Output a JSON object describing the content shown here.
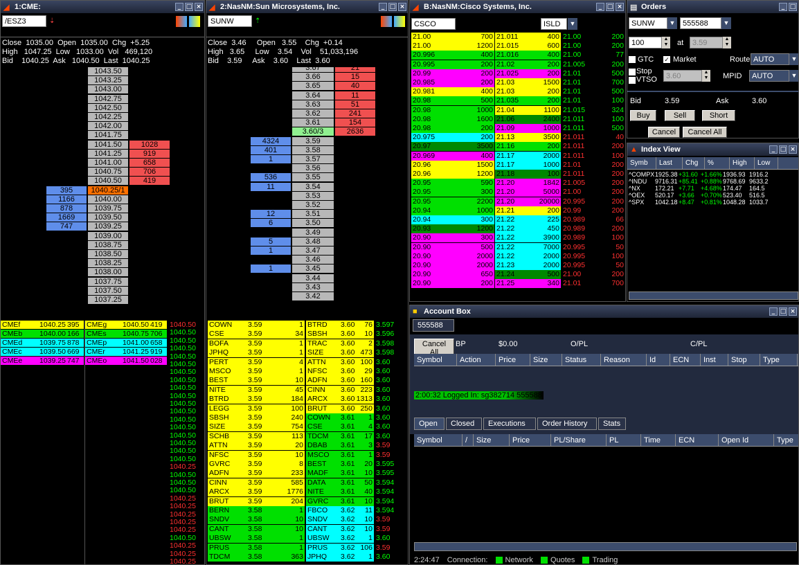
{
  "win1": {
    "title": "1:CME:",
    "symbol": "/ESZ3",
    "q": [
      "Close  1035.00  Open  1035.00  Chg  +5.25",
      "High   1047.25  Low   1033.00  Vol   469,120",
      "Bid    1040.25  Ask   1040.50  Last  1040.25"
    ],
    "chg_color": "#00ff00"
  },
  "win2": {
    "title": "2:NasNM:Sun Microsystems, Inc.",
    "symbol": "SUNW",
    "q": [
      "Close  3.46     Open   3.55    Chg  +0.14",
      "High   3.65     Low    3.54    Vol    51,033,196",
      "Bid    3.59     Ask    3.60    Last  3.60"
    ]
  },
  "win3": {
    "title": "B:NasNM:Cisco Systems, Inc.",
    "symbol": "CSCO",
    "ecn": "ISLD"
  },
  "orders": {
    "title": "Orders",
    "symbol": "SUNW",
    "account": "555588",
    "qty": "100",
    "at": "at",
    "price": "3.59",
    "gtc": "GTC",
    "market": "Market",
    "route_label": "Route",
    "route": "AUTO",
    "stop": "Stop",
    "vtso": "VTSO",
    "stop_price": "3.60",
    "mpid_label": "MPID",
    "mpid": "AUTO",
    "bid_label": "Bid",
    "bid": "3.59",
    "ask_label": "Ask",
    "ask": "3.60",
    "buy": "Buy",
    "sell": "Sell",
    "short": "Short",
    "cancel": "Cancel",
    "cancel_all": "Cancel All"
  },
  "index": {
    "title": "Index View",
    "cols": [
      "Symb",
      "Last",
      "Chg",
      "%",
      "High",
      "Low"
    ],
    "rows": [
      [
        "^COMPX",
        "1925.38",
        "+31.60",
        "+1.66%",
        "1936.93",
        "1916.2"
      ],
      [
        "^INDU",
        "9716.31",
        "+85.41",
        "+0.88%",
        "9768.69",
        "9633.2"
      ],
      [
        "^NX",
        "172.21",
        "+7.71",
        "+4.68%",
        "174.47",
        "164.5"
      ],
      [
        "^OEX",
        "520.17",
        "+3.66",
        "+0.70%",
        "523.40",
        "516.5"
      ],
      [
        "^SPX",
        "1042.18",
        "+8.47",
        "+0.81%",
        "1048.28",
        "1033.7"
      ]
    ]
  },
  "account": {
    "title": "Account Box",
    "id": "555588",
    "cancel_all": "Cancel All",
    "bp_label": "BP",
    "bp": "$0.00",
    "opl": "O/PL",
    "cpl": "C/PL",
    "cols": [
      "Symbol",
      "Action",
      "Price",
      "Size",
      "Status",
      "Reason",
      "Id",
      "ECN",
      "Inst",
      "Stop",
      "Type"
    ],
    "log": "2:00:32 Logged In: sg382714 555588",
    "tabs": [
      "Open",
      "Closed",
      "Executions",
      "Order History",
      "Stats"
    ],
    "cols2": [
      "Symbol",
      "/",
      "Size",
      "Price",
      "PL/Share",
      "PL",
      "Time",
      "ECN",
      "Open Id",
      "Type"
    ],
    "status_time": "2:24:47",
    "conn": "Connection:",
    "network": "Network",
    "quotes": "Quotes",
    "trading": "Trading"
  },
  "ladder1": [
    [
      "",
      "1043.50",
      ""
    ],
    [
      "",
      "1043.25",
      ""
    ],
    [
      "",
      "1043.00",
      ""
    ],
    [
      "",
      "1042.75",
      ""
    ],
    [
      "",
      "1042.50",
      ""
    ],
    [
      "",
      "1042.25",
      ""
    ],
    [
      "",
      "1042.00",
      ""
    ],
    [
      "",
      "1041.75",
      ""
    ],
    [
      "",
      "1041.50",
      "1028"
    ],
    [
      "",
      "1041.25",
      "919"
    ],
    [
      "",
      "1041.00",
      "658"
    ],
    [
      "",
      "1040.75",
      "706"
    ],
    [
      "",
      "1040.50",
      "419"
    ],
    [
      "395",
      "1040.25/1",
      ""
    ],
    [
      "1166",
      "1040.00",
      ""
    ],
    [
      "878",
      "1039.75",
      ""
    ],
    [
      "1669",
      "1039.50",
      ""
    ],
    [
      "747",
      "1039.25",
      ""
    ],
    [
      "",
      "1039.00",
      ""
    ],
    [
      "",
      "1038.75",
      ""
    ],
    [
      "",
      "1038.50",
      ""
    ],
    [
      "",
      "1038.25",
      ""
    ],
    [
      "",
      "1038.00",
      ""
    ],
    [
      "",
      "1037.75",
      ""
    ],
    [
      "",
      "1037.50",
      ""
    ],
    [
      "",
      "1037.25",
      ""
    ]
  ],
  "ladder2": [
    [
      "",
      "3.67",
      "21"
    ],
    [
      "",
      "3.66",
      "15"
    ],
    [
      "",
      "3.65",
      "40"
    ],
    [
      "",
      "3.64",
      "11"
    ],
    [
      "",
      "3.63",
      "51"
    ],
    [
      "",
      "3.62",
      "241"
    ],
    [
      "",
      "3.61",
      "154"
    ],
    [
      "",
      "3.60/3",
      "2636"
    ],
    [
      "4324",
      "3.59",
      ""
    ],
    [
      "401",
      "3.58",
      ""
    ],
    [
      "1",
      "3.57",
      ""
    ],
    [
      "",
      "3.56",
      ""
    ],
    [
      "536",
      "3.55",
      ""
    ],
    [
      "11",
      "3.54",
      ""
    ],
    [
      "",
      "3.53",
      ""
    ],
    [
      "",
      "3.52",
      ""
    ],
    [
      "12",
      "3.51",
      ""
    ],
    [
      "6",
      "3.50",
      ""
    ],
    [
      "",
      "3.49",
      ""
    ],
    [
      "5",
      "3.48",
      ""
    ],
    [
      "1",
      "3.47",
      ""
    ],
    [
      "",
      "3.46",
      ""
    ],
    [
      "1",
      "3.45",
      ""
    ],
    [
      "",
      "3.44",
      ""
    ],
    [
      "",
      "3.43",
      ""
    ],
    [
      "",
      "3.42",
      ""
    ]
  ],
  "cme_mm": [
    [
      "CMEf",
      "1040.25",
      "395",
      "CMEg",
      "1040.50",
      "419",
      "#ffff00"
    ],
    [
      "CMEb",
      "1040.00",
      "166",
      "CMEs",
      "1040.75",
      "706",
      "#00e000"
    ],
    [
      "CMEd",
      "1039.75",
      "878",
      "CMEp",
      "1041.00",
      "658",
      "#00ffff"
    ],
    [
      "CMEc",
      "1039.50",
      "669",
      "CMEr",
      "1041.25",
      "919",
      "#00ffff"
    ],
    [
      "CMEe",
      "1039.25",
      "747",
      "CMEo",
      "1041.50",
      "028",
      "#ff00ff"
    ]
  ],
  "cme_ts": [
    [
      "1040.50",
      "1",
      "#ff3030"
    ],
    [
      "1040.50",
      "",
      "#00ff00"
    ],
    [
      "1040.50",
      "",
      "#00ff00"
    ],
    [
      "1040.50",
      "",
      "#00ff00"
    ],
    [
      "1040.50",
      "",
      "#00ff00"
    ],
    [
      "1040.50",
      "",
      "#00ff00"
    ],
    [
      "1040.50",
      "",
      "#00ff00"
    ],
    [
      "1040.50",
      "",
      "#00ff00"
    ],
    [
      "1040.50",
      "",
      "#00ff00"
    ],
    [
      "1040.50",
      "",
      "#00ff00"
    ],
    [
      "1040.50",
      "",
      "#00ff00"
    ],
    [
      "1040.50",
      "",
      "#00ff00"
    ],
    [
      "1040.50",
      "",
      "#00ff00"
    ],
    [
      "1040.50",
      "",
      "#00ff00"
    ],
    [
      "1040.50",
      "",
      "#00ff00"
    ],
    [
      "1040.50",
      "",
      "#00ff00"
    ],
    [
      "1040.50",
      "",
      "#00ff00"
    ],
    [
      "1040.50",
      "",
      "#00ff00"
    ],
    [
      "1040.25",
      "",
      "#ff3030"
    ],
    [
      "1040.50",
      "",
      "#00ff00"
    ],
    [
      "1040.50",
      "",
      "#00ff00"
    ],
    [
      "1040.50",
      "",
      "#00ff00"
    ],
    [
      "1040.25",
      "1",
      "#ff3030"
    ],
    [
      "1040.25",
      "",
      "#ff3030"
    ],
    [
      "1040.25",
      "",
      "#ff3030"
    ],
    [
      "1040.25",
      "",
      "#ff3030"
    ],
    [
      "1040.25",
      "",
      "#ff3030"
    ],
    [
      "1040.50",
      "",
      "#00ff00"
    ],
    [
      "1040.25",
      "",
      "#ff3030"
    ],
    [
      "1040.25",
      "",
      "#ff3030"
    ],
    [
      "1040.25",
      "",
      "#ff3030"
    ]
  ],
  "sun_bids": [
    [
      "COWN",
      "3.59",
      "1",
      "#ffff00"
    ],
    [
      "CSE",
      "3.59",
      "34",
      "#ffff00"
    ],
    [
      "BOFA",
      "3.59",
      "1",
      "#ffff00"
    ],
    [
      "JPHQ",
      "3.59",
      "1",
      "#ffff00"
    ],
    [
      "PERT",
      "3.59",
      "4",
      "#ffff00"
    ],
    [
      "MSCO",
      "3.59",
      "1",
      "#ffff00"
    ],
    [
      "BEST",
      "3.59",
      "10",
      "#ffff00"
    ],
    [
      "NITE",
      "3.59",
      "45",
      "#ffff00"
    ],
    [
      "BTRD",
      "3.59",
      "184",
      "#ffff00"
    ],
    [
      "LEGG",
      "3.59",
      "100",
      "#ffff00"
    ],
    [
      "SBSH",
      "3.59",
      "240",
      "#ffff00"
    ],
    [
      "SIZE",
      "3.59",
      "754",
      "#ffff00"
    ],
    [
      "SCHB",
      "3.59",
      "113",
      "#ffff00"
    ],
    [
      "ATTN",
      "3.59",
      "20",
      "#ffff00"
    ],
    [
      "NFSC",
      "3.59",
      "10",
      "#ffff00"
    ],
    [
      "GVRC",
      "3.59",
      "8",
      "#ffff00"
    ],
    [
      "ADFN",
      "3.59",
      "233",
      "#ffff00"
    ],
    [
      "CINN",
      "3.59",
      "585",
      "#ffff00"
    ],
    [
      "ARCX",
      "3.59",
      "1776",
      "#ffff00"
    ],
    [
      "BRUT",
      "3.59",
      "204",
      "#ffff00"
    ],
    [
      "BERN",
      "3.58",
      "1",
      "#00e000"
    ],
    [
      "SNDV",
      "3.58",
      "10",
      "#00e000"
    ],
    [
      "CANT",
      "3.58",
      "10",
      "#00e000"
    ],
    [
      "UBSW",
      "3.58",
      "1",
      "#00e000"
    ],
    [
      "PRUS",
      "3.58",
      "1",
      "#00e000"
    ],
    [
      "TDCM",
      "3.58",
      "363",
      "#00e000"
    ]
  ],
  "sun_asks": [
    [
      "BTRD",
      "3.60",
      "76",
      "#ffff00"
    ],
    [
      "SBSH",
      "3.60",
      "10",
      "#ffff00"
    ],
    [
      "TRAC",
      "3.60",
      "2",
      "#ffff00"
    ],
    [
      "SIZE",
      "3.60",
      "473",
      "#ffff00"
    ],
    [
      "ATTN",
      "3.60",
      "100",
      "#ffff00"
    ],
    [
      "NFSC",
      "3.60",
      "29",
      "#ffff00"
    ],
    [
      "ADFN",
      "3.60",
      "160",
      "#ffff00"
    ],
    [
      "CINN",
      "3.60",
      "223",
      "#ffff00"
    ],
    [
      "ARCX",
      "3.60",
      "1313",
      "#ffff00"
    ],
    [
      "BRUT",
      "3.60",
      "250",
      "#ffff00"
    ],
    [
      "COWN",
      "3.61",
      "1",
      "#00e000"
    ],
    [
      "CSE",
      "3.61",
      "4",
      "#00e000"
    ],
    [
      "TDCM",
      "3.61",
      "17",
      "#00e000"
    ],
    [
      "DBAB",
      "3.61",
      "3",
      "#00e000"
    ],
    [
      "MSCO",
      "3.61",
      "1",
      "#00e000"
    ],
    [
      "BEST",
      "3.61",
      "20",
      "#00e000"
    ],
    [
      "MADF",
      "3.61",
      "10",
      "#00e000"
    ],
    [
      "DATA",
      "3.61",
      "50",
      "#00e000"
    ],
    [
      "NITE",
      "3.61",
      "40",
      "#00e000"
    ],
    [
      "GVRC",
      "3.61",
      "10",
      "#00e000"
    ],
    [
      "FBCO",
      "3.62",
      "11",
      "#00ffff"
    ],
    [
      "SNDV",
      "3.62",
      "10",
      "#00ffff"
    ],
    [
      "CANT",
      "3.62",
      "10",
      "#00ffff"
    ],
    [
      "UBSW",
      "3.62",
      "1",
      "#00ffff"
    ],
    [
      "PRUS",
      "3.62",
      "106",
      "#00ffff"
    ],
    [
      "JPHQ",
      "3.62",
      "1",
      "#00ffff"
    ]
  ],
  "sun_ts": [
    [
      "3.597",
      "#00ff00"
    ],
    [
      "3.596",
      "#00ff00"
    ],
    [
      "3.598",
      "#00ff00"
    ],
    [
      "3.598",
      "#00ff00"
    ],
    [
      "3.60",
      "#00ff00"
    ],
    [
      "3.60",
      "#00ff00"
    ],
    [
      "3.60",
      "#00ff00"
    ],
    [
      "3.60",
      "#00ff00"
    ],
    [
      "3.60",
      "#00ff00"
    ],
    [
      "3.60",
      "#00ff00"
    ],
    [
      "3.60",
      "#00ff00"
    ],
    [
      "3.60",
      "#00ff00"
    ],
    [
      "3.60",
      "#00ff00"
    ],
    [
      "3.59",
      "#ff3030"
    ],
    [
      "3.59",
      "#ff3030"
    ],
    [
      "3.595",
      "#00ff00"
    ],
    [
      "3.595",
      "#00ff00"
    ],
    [
      "3.594",
      "#00ff00"
    ],
    [
      "3.594",
      "#00ff00"
    ],
    [
      "3.594",
      "#00ff00"
    ],
    [
      "3.594",
      "#00ff00"
    ],
    [
      "3.59",
      "#ff3030"
    ],
    [
      "3.59",
      "#ff3030"
    ],
    [
      "3.60",
      "#00ff00"
    ],
    [
      "3.59",
      "#ff3030"
    ],
    [
      "3.60",
      "#00ff00"
    ]
  ],
  "csco_bids": [
    [
      "21.00",
      "700",
      "#ffff00"
    ],
    [
      "21.00",
      "1200",
      "#ffff00"
    ],
    [
      "20.996",
      "400",
      "#00e000"
    ],
    [
      "20.995",
      "200",
      "#00e000"
    ],
    [
      "20.99",
      "200",
      "#ff00ff"
    ],
    [
      "20.985",
      "200",
      "#ff00ff"
    ],
    [
      "20.981",
      "400",
      "#ffff00"
    ],
    [
      "20.98",
      "500",
      "#00e000"
    ],
    [
      "20.98",
      "1000",
      "#00e000"
    ],
    [
      "20.98",
      "1600",
      "#00e000"
    ],
    [
      "20.98",
      "200",
      "#00e000"
    ],
    [
      "20.975",
      "200",
      "#00ffff"
    ],
    [
      "20.97",
      "3500",
      "#008800"
    ],
    [
      "20.969",
      "400",
      "#ff00ff"
    ],
    [
      "20.96",
      "1500",
      "#ffff00"
    ],
    [
      "20.96",
      "1200",
      "#ffff00"
    ],
    [
      "20.95",
      "590",
      "#00e000"
    ],
    [
      "20.95",
      "300",
      "#00e000"
    ],
    [
      "20.95",
      "2200",
      "#00e000"
    ],
    [
      "20.94",
      "1000",
      "#00e000"
    ],
    [
      "20.94",
      "300",
      "#00ffff"
    ],
    [
      "20.93",
      "1200",
      "#008800"
    ],
    [
      "20.90",
      "300",
      "#ff00ff"
    ],
    [
      "20.90",
      "500",
      "#ff00ff"
    ],
    [
      "20.90",
      "2000",
      "#ff00ff"
    ],
    [
      "20.90",
      "2000",
      "#ff00ff"
    ],
    [
      "20.90",
      "650",
      "#ff00ff"
    ],
    [
      "20.90",
      "200",
      "#ff00ff"
    ]
  ],
  "csco_asks": [
    [
      "21.011",
      "400",
      "21.00",
      "200",
      "#ffff00"
    ],
    [
      "21.015",
      "600",
      "21.00",
      "200",
      "#ffff00"
    ],
    [
      "21.016",
      "400",
      "21.00",
      "77",
      "#00e000"
    ],
    [
      "21.02",
      "200",
      "21.005",
      "200",
      "#00e000"
    ],
    [
      "21.025",
      "200",
      "21.01",
      "500",
      "#ff00ff"
    ],
    [
      "21.03",
      "1500",
      "21.01",
      "700",
      "#ffff00"
    ],
    [
      "21.03",
      "200",
      "21.01",
      "500",
      "#ffff00"
    ],
    [
      "21.035",
      "200",
      "21.01",
      "100",
      "#00e000"
    ],
    [
      "21.04",
      "1100",
      "21.015",
      "324",
      "#ffff00"
    ],
    [
      "21.06",
      "2400",
      "21.011",
      "100",
      "#008800"
    ],
    [
      "21.09",
      "1000",
      "21.011",
      "500",
      "#ff00ff"
    ],
    [
      "21.13",
      "3500",
      "21.011",
      "40",
      "#ffff00"
    ],
    [
      "21.16",
      "200",
      "21.011",
      "200",
      "#00e000"
    ],
    [
      "21.17",
      "2000",
      "21.011",
      "100",
      "#00ffff"
    ],
    [
      "21.17",
      "1000",
      "21.01",
      "200",
      "#00ffff"
    ],
    [
      "21.18",
      "100",
      "21.011",
      "200",
      "#008800"
    ],
    [
      "21.20",
      "1842",
      "21.005",
      "200",
      "#ff00ff"
    ],
    [
      "21.20",
      "5000",
      "21.00",
      "200",
      "#ff00ff"
    ],
    [
      "21.20",
      "20000",
      "20.995",
      "200",
      "#ff00ff"
    ],
    [
      "21.21",
      "200",
      "20.99",
      "200",
      "#ffff00"
    ],
    [
      "21.22",
      "225",
      "20.989",
      "66",
      "#00ffff"
    ],
    [
      "21.22",
      "450",
      "20.989",
      "200",
      "#00ffff"
    ],
    [
      "21.22",
      "3900",
      "20.989",
      "100",
      "#00ffff"
    ],
    [
      "21.22",
      "7000",
      "20.995",
      "50",
      "#00ffff"
    ],
    [
      "21.22",
      "2000",
      "20.995",
      "100",
      "#00ffff"
    ],
    [
      "21.23",
      "2000",
      "20.995",
      "50",
      "#00ffff"
    ],
    [
      "21.24",
      "500",
      "21.00",
      "200",
      "#008800"
    ],
    [
      "21.25",
      "340",
      "21.01",
      "700",
      "#ff00ff"
    ]
  ]
}
